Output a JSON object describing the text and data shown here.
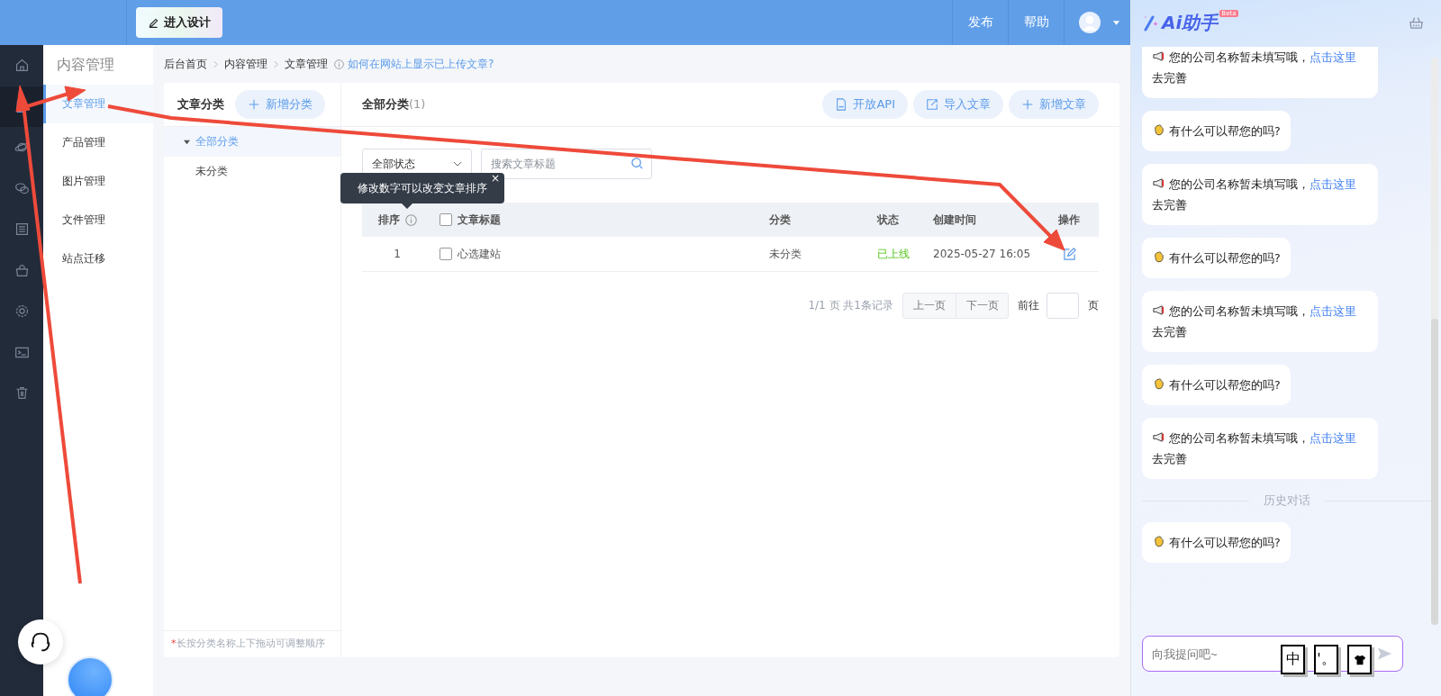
{
  "topbar": {
    "design_button": "进入设计",
    "nav": [
      "发布",
      "帮助"
    ]
  },
  "rail": [
    {
      "kind": "home",
      "selected": false
    },
    {
      "kind": "document",
      "selected": true
    },
    {
      "kind": "planet",
      "selected": false
    },
    {
      "kind": "chat",
      "selected": false
    },
    {
      "kind": "list",
      "selected": false
    },
    {
      "kind": "bag",
      "selected": false
    },
    {
      "kind": "gear",
      "selected": false
    },
    {
      "kind": "terminal",
      "selected": false
    },
    {
      "kind": "trash",
      "selected": false
    }
  ],
  "sidebar": {
    "title": "内容管理",
    "items": [
      {
        "label": "文章管理",
        "selected": true
      },
      {
        "label": "产品管理",
        "selected": false
      },
      {
        "label": "图片管理",
        "selected": false
      },
      {
        "label": "文件管理",
        "selected": false
      },
      {
        "label": "站点迁移",
        "selected": false
      }
    ]
  },
  "breadcrumb": {
    "items": [
      "后台首页",
      "内容管理",
      "文章管理"
    ],
    "help_link": "如何在网站上显示已上传文章?"
  },
  "categories": {
    "title": "文章分类",
    "add_button": "新增分类",
    "tree": [
      {
        "label": "全部分类",
        "selected": true,
        "expanded": true
      },
      {
        "label": "未分类",
        "selected": false
      }
    ],
    "hint_mark": "*",
    "hint": "长按分类名称上下拖动可调整顺序"
  },
  "articles": {
    "title": "全部分类",
    "count": "(1)",
    "buttons": [
      {
        "kind": "api",
        "label": "开放API"
      },
      {
        "kind": "import",
        "label": "导入文章"
      },
      {
        "kind": "add",
        "label": "新增文章"
      }
    ],
    "status_select": "全部状态",
    "search": {
      "placeholder": "搜索文章标题"
    },
    "tooltip": {
      "text": "修改数字可以改变文章排序",
      "close": "×"
    },
    "columns": [
      "排序",
      "文章标题",
      "分类",
      "状态",
      "创建时间",
      "操作"
    ],
    "header_checked": false,
    "rows": [
      {
        "order": "1",
        "checked": false,
        "title": "心选建站",
        "category": "未分类",
        "status": "已上线",
        "published": true,
        "created": "2025-05-27 16:05"
      }
    ],
    "pagination": {
      "info": "1/1 页 共1条记录",
      "prev": "上一页",
      "next": "下一页",
      "goto": "前往",
      "suffix": "页"
    }
  },
  "assistant": {
    "title": "Ai助手",
    "badge": "Beta",
    "messages": [
      {
        "kind": "notice",
        "text": "您的公司名称暂未填写哦，",
        "link": "点击这里",
        "after": "去完善"
      },
      {
        "kind": "greeting",
        "text": "有什么可以帮您的吗?"
      },
      {
        "kind": "notice",
        "text": "您的公司名称暂未填写哦，",
        "link": "点击这里",
        "after": "去完善"
      },
      {
        "kind": "greeting",
        "text": "有什么可以帮您的吗?"
      },
      {
        "kind": "notice",
        "text": "您的公司名称暂未填写哦，",
        "link": "点击这里",
        "after": "去完善"
      },
      {
        "kind": "greeting",
        "text": "有什么可以帮您的吗?"
      },
      {
        "kind": "notice",
        "text": "您的公司名称暂未填写哦，",
        "link": "点击这里",
        "after": "去完善"
      },
      {
        "kind": "divider",
        "text": "历史对话"
      },
      {
        "kind": "greeting",
        "text": "有什么可以帮您的吗?"
      }
    ],
    "input": {
      "placeholder": "向我提问吧~"
    },
    "ime": [
      "中",
      "'。"
    ]
  }
}
